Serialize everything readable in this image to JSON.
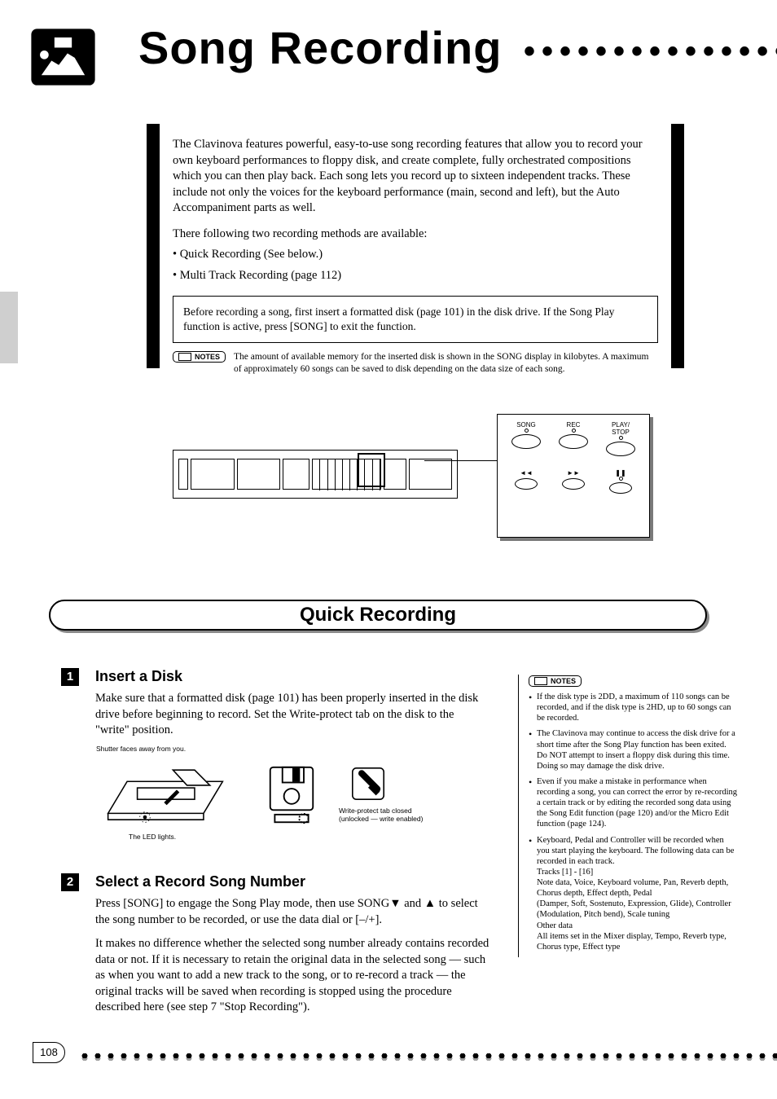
{
  "title": "Song Recording",
  "intro": {
    "para": "The Clavinova features powerful, easy-to-use song recording features that allow you to record your own keyboard performances to floppy disk, and create complete, fully orchestrated compositions which you can then play back. Each song lets you record up to sixteen independent tracks. These include not only the voices for the keyboard performance (main, second and left), but the Auto Accompaniment parts as well.",
    "methods_intro": "There following two recording methods are available:",
    "m1": "• Quick Recording (See below.)",
    "m2": "• Multi Track Recording (page 112)",
    "box": "Before recording a song, first insert a formatted disk (page 101) in the disk drive. If the Song Play function is active, press [SONG] to exit the function.",
    "intro_note": "The amount of available memory for the inserted disk is shown in the SONG display in kilobytes. A maximum of approximately 60 songs can be saved to disk depending on the data size of each song."
  },
  "callout": {
    "row1": [
      "SONG",
      "REC",
      "PLAY/\nSTOP"
    ],
    "row2": [
      "REW",
      "FF",
      "PAUSE"
    ]
  },
  "section_header": "Quick Recording",
  "step1": {
    "num": "1",
    "title": "Insert a Disk",
    "body": "Make sure that a formatted disk (page 101) has been properly inserted in the disk drive before beginning to record. Set the Write-protect tab on the disk to the \"write\" position.",
    "cap_left": "Shutter faces away from you.",
    "cap_mid": "The LED lights.",
    "cap_right": "Write-protect tab closed\n(unlocked — write enabled)"
  },
  "step2": {
    "num": "2",
    "title": "Select a Record Song Number",
    "body1": "Press [SONG] to engage the Song Play mode, then use SONG▼ and ▲ to select the song number to be recorded, or use the data dial or [–/+].",
    "body2": "It makes no difference whether the selected song number already contains recorded data or not. If it is necessary to retain the original data in the selected song — such as when you want to add a new track to the song, or to re-record a track — the original tracks will be saved when recording is stopped using the procedure described here (see step 7 \"Stop Recording\")."
  },
  "right_notes": {
    "label": "NOTES",
    "items": [
      "If the disk type is 2DD, a maximum of 110 songs can be recorded, and if the disk type is 2HD, up to 60 songs can be recorded.",
      "The Clavinova may continue to access the disk drive for a short time after the Song Play function has been exited. Do NOT attempt to insert a floppy disk during this time. Doing so may damage the disk drive.",
      "Even if you make a mistake in performance when recording a song, you can correct the error by re-recording a certain track or by editing the recorded song data using the Song Edit function (page 120) and/or the Micro Edit function (page 124).",
      "Keyboard, Pedal and Controller will be recorded when you start playing the keyboard. The following data can be recorded in each track.\nTracks [1] - [16]\nNote data, Voice, Keyboard volume, Pan, Reverb depth, Chorus depth, Effect depth, Pedal\n(Damper, Soft, Sostenuto, Expression, Glide), Controller (Modulation, Pitch bend), Scale tuning\nOther data\nAll items set in the Mixer display, Tempo, Reverb type, Chorus type, Effect type"
    ]
  },
  "page_number": "108",
  "notes_label": "NOTES"
}
